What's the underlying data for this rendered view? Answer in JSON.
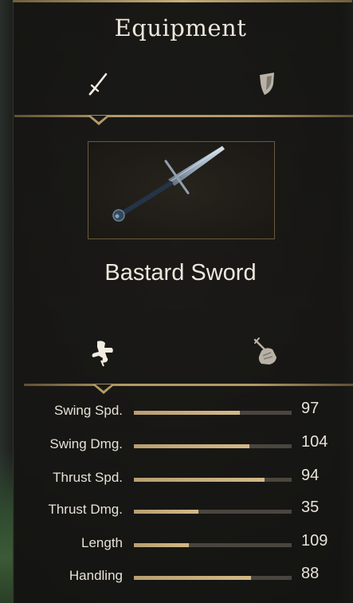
{
  "panel": {
    "title": "Equipment"
  },
  "equipment_tabs": [
    {
      "icon": "sword-icon",
      "selected": true
    },
    {
      "icon": "shield-icon",
      "selected": false
    }
  ],
  "weapon": {
    "name": "Bastard Sword",
    "image": "bastard-sword-icon"
  },
  "stat_tabs": [
    {
      "icon": "swing-stance-icon",
      "selected": true
    },
    {
      "icon": "thrust-hand-icon",
      "selected": false
    }
  ],
  "stats": [
    {
      "label": "Swing Spd.",
      "value": "97",
      "fill": 0.67
    },
    {
      "label": "Swing Dmg.",
      "value": "104",
      "fill": 0.73
    },
    {
      "label": "Thrust Spd.",
      "value": "94",
      "fill": 0.83
    },
    {
      "label": "Thrust Dmg.",
      "value": "35",
      "fill": 0.41
    },
    {
      "label": "Length",
      "value": "109",
      "fill": 0.35
    },
    {
      "label": "Handling",
      "value": "88",
      "fill": 0.74
    }
  ],
  "colors": {
    "accent_gold": "#b39a66",
    "text": "#ece7dc",
    "bar_fill": "#c9b07e",
    "bar_track": "#4a463f"
  }
}
